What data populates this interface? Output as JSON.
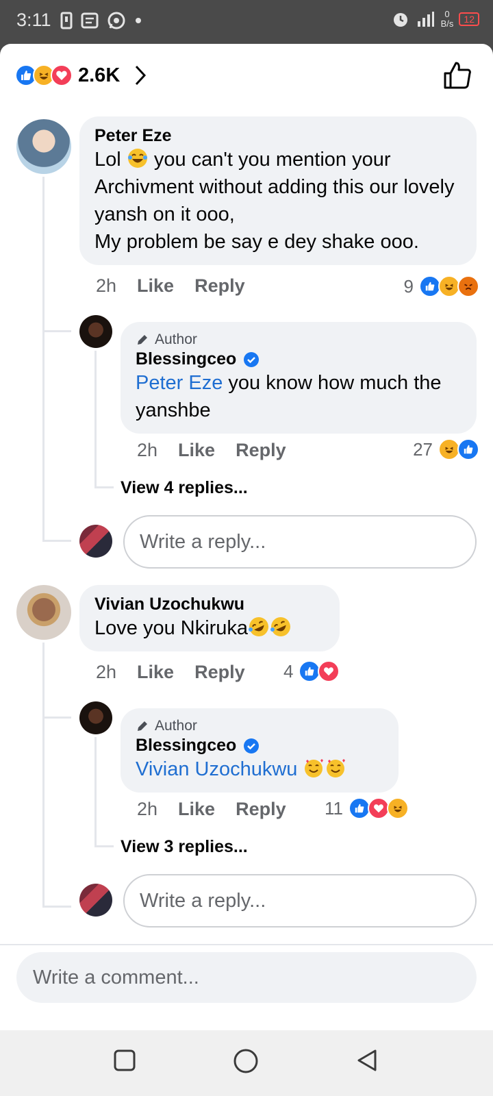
{
  "status_bar": {
    "time": "3:11",
    "network_speed": "0\nB/s",
    "battery": "12"
  },
  "post_reactions": {
    "count": "2.6K",
    "types": [
      "like",
      "haha",
      "love"
    ]
  },
  "comments": [
    {
      "author": "Peter Eze",
      "text_parts": [
        "Lol ",
        " you can't you mention your Archivment without adding this our lovely yansh on it ooo,",
        "My problem be say e dey shake ooo."
      ],
      "time": "2h",
      "like_label": "Like",
      "reply_label": "Reply",
      "reaction_count": "9",
      "reaction_types": [
        "like",
        "haha",
        "angry"
      ],
      "reply": {
        "author_tag": "Author",
        "author": "Blessingceo",
        "mention": "Peter Eze",
        "text": " you know how much the yanshbe",
        "time": "2h",
        "like_label": "Like",
        "reply_label": "Reply",
        "reaction_count": "27",
        "reaction_types": [
          "haha",
          "like"
        ]
      },
      "view_replies": "View 4 replies...",
      "reply_placeholder": "Write a reply..."
    },
    {
      "author": "Vivian Uzochukwu",
      "text": "Love you Nkiruka",
      "time": "2h",
      "like_label": "Like",
      "reply_label": "Reply",
      "reaction_count": "4",
      "reaction_types": [
        "like",
        "love"
      ],
      "reply": {
        "author_tag": "Author",
        "author": "Blessingceo",
        "mention": "Vivian Uzochukwu",
        "time": "2h",
        "like_label": "Like",
        "reply_label": "Reply",
        "reaction_count": "11",
        "reaction_types": [
          "like",
          "love",
          "haha"
        ]
      },
      "view_replies": "View 3 replies...",
      "reply_placeholder": "Write a reply..."
    }
  ],
  "comment_input": {
    "placeholder": "Write a comment..."
  },
  "colors": {
    "like": "#1877f2",
    "love": "#f33e58",
    "haha": "#f7b125",
    "angry": "#e9710f",
    "mention": "#1f6ed1",
    "bubble": "#f0f2f5"
  },
  "nav": [
    "recent-apps-button",
    "home-button",
    "back-button"
  ]
}
